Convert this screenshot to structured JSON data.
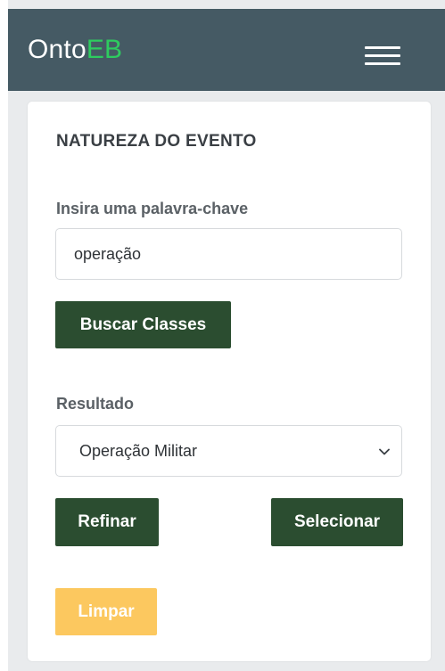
{
  "navbar": {
    "brand_prefix": "Onto",
    "brand_accent": "EB",
    "menu_icon": "hamburger-menu-icon",
    "background_color": "#455a64",
    "accent_color": "#2ecc5f"
  },
  "form": {
    "section_title": "NATUREZA DO EVENTO",
    "keyword_label": "Insira uma palavra-chave",
    "keyword_value": "operação",
    "search_button": "Buscar Classes",
    "result_label": "Resultado",
    "result_selected": "Operação Militar",
    "dropdown_icon": "chevron-down-icon",
    "refine_button": "Refinar",
    "select_button": "Selecionar",
    "clear_button": "Limpar",
    "primary_button_color": "#2b4d30",
    "clear_button_color": "#fcc85f"
  }
}
